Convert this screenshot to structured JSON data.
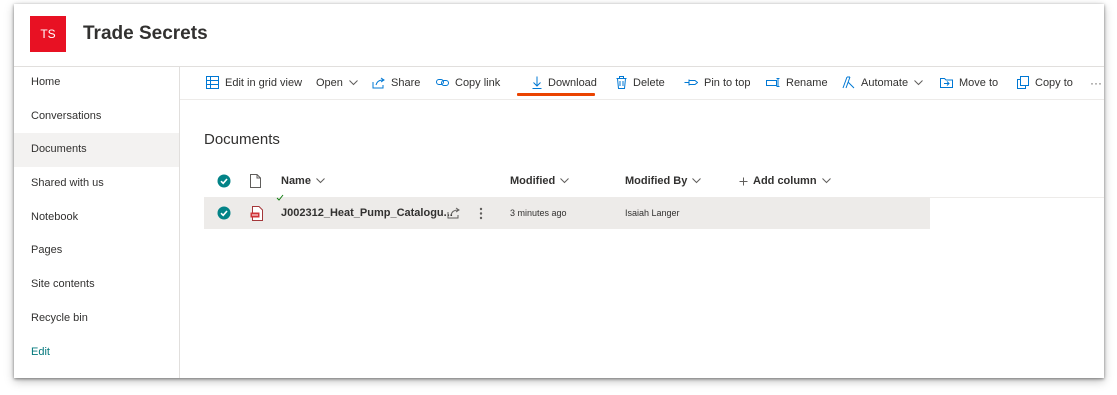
{
  "site": {
    "logo_text": "TS",
    "title": "Trade Secrets",
    "logo_color": "#e81123"
  },
  "nav": {
    "items": [
      {
        "label": "Home"
      },
      {
        "label": "Conversations"
      },
      {
        "label": "Documents",
        "selected": true
      },
      {
        "label": "Shared with us"
      },
      {
        "label": "Notebook"
      },
      {
        "label": "Pages"
      },
      {
        "label": "Site contents"
      },
      {
        "label": "Recycle bin"
      },
      {
        "label": "Edit"
      }
    ]
  },
  "command_bar": {
    "edit_grid": "Edit in grid view",
    "open": "Open",
    "share": "Share",
    "copy_link": "Copy link",
    "download": "Download",
    "delete": "Delete",
    "pin": "Pin to top",
    "rename": "Rename",
    "automate": "Automate",
    "move_to": "Move to",
    "copy_to": "Copy to",
    "more": "···",
    "highlight_color": "#ea4300"
  },
  "library": {
    "title": "Documents",
    "columns": {
      "name": "Name",
      "modified": "Modified",
      "modified_by": "Modified By",
      "add_column": "Add column"
    },
    "rows": [
      {
        "name": "J002312_Heat_Pump_Catalogu...",
        "modified": "3 minutes ago",
        "modified_by": "Isaiah Langer",
        "file_type_icon": "pdf-file-icon",
        "selected": true
      }
    ]
  },
  "colors": {
    "accent": "#03787c",
    "selected_row": "#edebe9",
    "check_teal": "#038387"
  }
}
